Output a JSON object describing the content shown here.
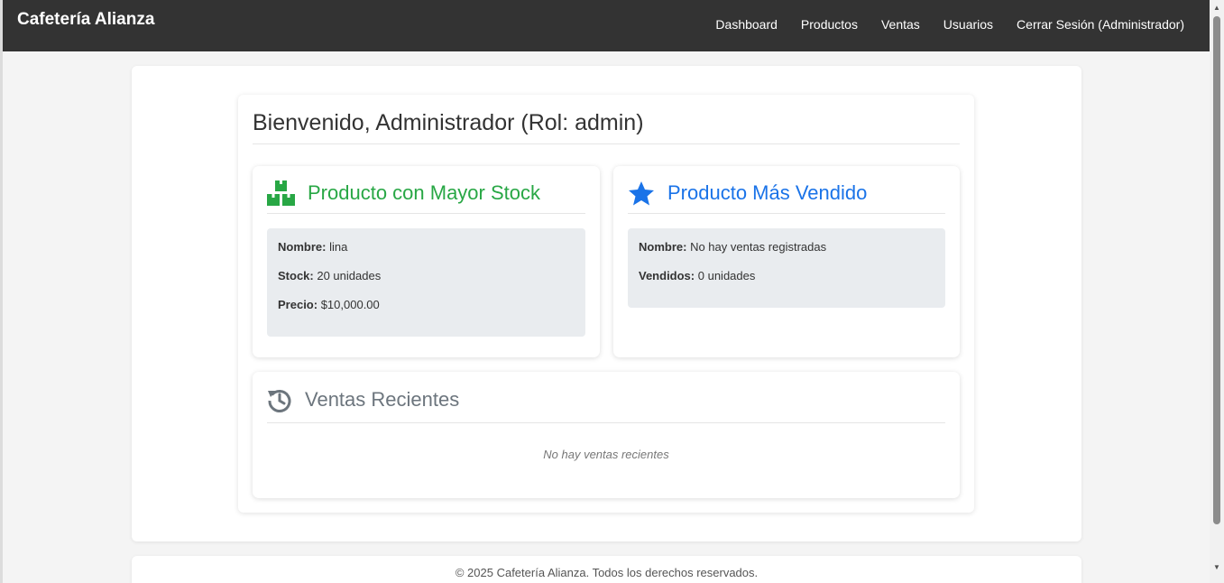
{
  "app": {
    "brand": "Cafetería Alianza"
  },
  "nav": {
    "items": [
      "Dashboard",
      "Productos",
      "Ventas",
      "Usuarios",
      "Cerrar Sesión (Administrador)"
    ]
  },
  "dashboard": {
    "welcome": "Bienvenido, Administrador (Rol: admin)",
    "top_stock": {
      "title": "Producto con Mayor Stock",
      "icon": "boxes-icon",
      "color": "#28a745",
      "name_label": "Nombre:",
      "name_value": "lina",
      "stock_label": "Stock:",
      "stock_value": "20 unidades",
      "price_label": "Precio:",
      "price_value": "$10,000.00"
    },
    "top_sold": {
      "title": "Producto Más Vendido",
      "icon": "star-icon",
      "color": "#1a73e8",
      "name_label": "Nombre:",
      "name_value": "No hay ventas registradas",
      "sold_label": "Vendidos:",
      "sold_value": "0 unidades"
    },
    "recent_sales": {
      "title": "Ventas Recientes",
      "icon": "history-icon",
      "color": "#6c757d",
      "empty_text": "No hay ventas recientes"
    }
  },
  "footer": {
    "text": "© 2025 Cafetería Alianza. Todos los derechos reservados."
  }
}
